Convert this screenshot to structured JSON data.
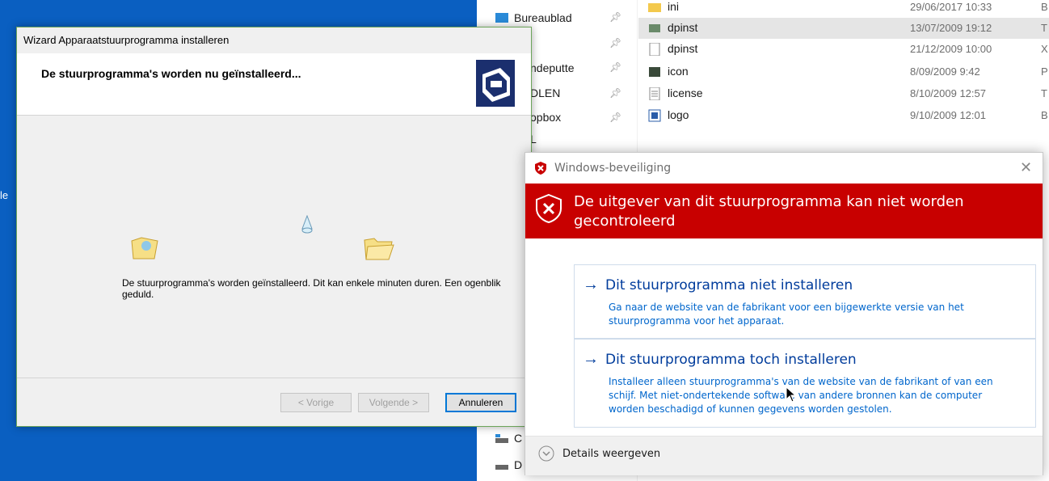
{
  "desktop": {
    "edge_text": "le"
  },
  "explorer": {
    "nav": [
      {
        "label": "Bureaublad",
        "pinned": true
      },
      {
        "label": "",
        "pinned": true
      },
      {
        "label": "ndeputte",
        "pinned": true
      },
      {
        "label": "DLEN",
        "pinned": true
      },
      {
        "label": "opbox",
        "pinned": true
      },
      {
        "label": "L",
        "pinned": false
      }
    ],
    "nav_bottom": [
      {
        "label": "C"
      },
      {
        "label": "D"
      }
    ],
    "files": [
      {
        "name": "ini",
        "date": "29/06/2017 10:33",
        "type": "B"
      },
      {
        "name": "dpinst",
        "date": "13/07/2009 19:12",
        "type": "T"
      },
      {
        "name": "dpinst",
        "date": "21/12/2009 10:00",
        "type": "X"
      },
      {
        "name": "icon",
        "date": "8/09/2009 9:42",
        "type": "P"
      },
      {
        "name": "license",
        "date": "8/10/2009 12:57",
        "type": "T"
      },
      {
        "name": "logo",
        "date": "9/10/2009 12:01",
        "type": "B"
      }
    ]
  },
  "wizard": {
    "title": "Wizard Apparaatstuurprogramma installeren",
    "heading": "De stuurprogramma's worden nu geïnstalleerd...",
    "message": "De stuurprogramma's worden geïnstalleerd. Dit kan enkele minuten duren. Een ogenblik geduld.",
    "buttons": {
      "back": "< Vorige",
      "next": "Volgende >",
      "cancel": "Annuleren"
    }
  },
  "security": {
    "title": "Windows-beveiliging",
    "banner": "De uitgever van dit stuurprogramma kan niet worden gecontroleerd",
    "options": [
      {
        "title": "Dit stuurprogramma niet installeren",
        "desc": "Ga naar de website van de fabrikant voor een bijgewerkte versie van het stuurprogramma voor het apparaat."
      },
      {
        "title": "Dit stuurprogramma toch installeren",
        "desc": "Installeer alleen stuurprogramma's van de website van de fabrikant of van een schijf. Met niet-ondertekende software van andere bronnen kan de computer worden beschadigd of kunnen gegevens worden gestolen."
      }
    ],
    "details": "Details weergeven"
  },
  "colors": {
    "desktop": "#0a5fc1",
    "banner": "#c80000",
    "link": "#003c9c"
  }
}
